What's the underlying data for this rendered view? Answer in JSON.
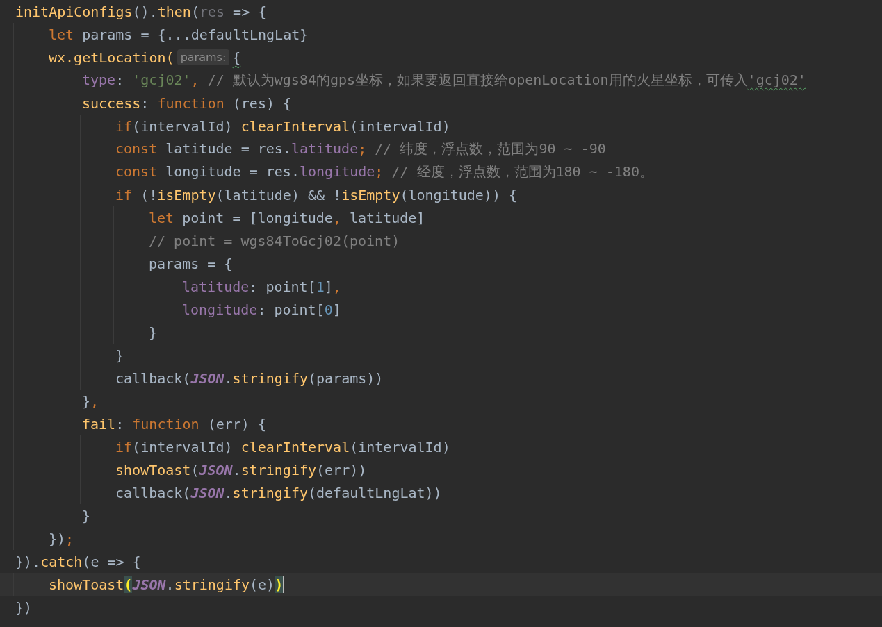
{
  "lines": [
    {
      "current": false,
      "tokens": [
        {
          "kind": "function",
          "text": "initApiConfigs"
        },
        {
          "kind": "plain",
          "text": "()."
        },
        {
          "kind": "function",
          "text": "then"
        },
        {
          "kind": "plain",
          "text": "("
        },
        {
          "kind": "unused",
          "text": "res"
        },
        {
          "kind": "plain",
          "text": " => {"
        }
      ],
      "children": [
        {
          "current": false,
          "tokens": [
            {
              "kind": "keyword",
              "text": "let"
            },
            {
              "kind": "plain",
              "text": " params = {...defaultLngLat}"
            }
          ]
        },
        {
          "current": false,
          "tokens": [
            {
              "kind": "function",
              "text": "wx.getLocation("
            },
            {
              "kind": "hint",
              "text": "params:"
            },
            {
              "kind": "flagged",
              "text": "{"
            }
          ],
          "children": [
            {
              "current": false,
              "tokens": [
                {
                  "kind": "property",
                  "text": "type"
                },
                {
                  "kind": "plain",
                  "text": ": "
                },
                {
                  "kind": "string",
                  "text": "'gcj02'"
                },
                {
                  "kind": "punct",
                  "text": ","
                },
                {
                  "kind": "comment",
                  "text": " // 默认为wgs84的gps坐标，如果要返回直接给openLocation用的火星坐标，可传入"
                },
                {
                  "kind": "flagcomment",
                  "text": "'gcj02'"
                }
              ]
            },
            {
              "current": false,
              "tokens": [
                {
                  "kind": "function",
                  "text": "success"
                },
                {
                  "kind": "plain",
                  "text": ": "
                },
                {
                  "kind": "keyword",
                  "text": "function"
                },
                {
                  "kind": "plain",
                  "text": " (res) {"
                }
              ],
              "children": [
                {
                  "current": false,
                  "tokens": [
                    {
                      "kind": "keyword",
                      "text": "if"
                    },
                    {
                      "kind": "plain",
                      "text": "(intervalId) "
                    },
                    {
                      "kind": "function",
                      "text": "clearInterval"
                    },
                    {
                      "kind": "plain",
                      "text": "(intervalId)"
                    }
                  ]
                },
                {
                  "current": false,
                  "tokens": [
                    {
                      "kind": "keyword",
                      "text": "const"
                    },
                    {
                      "kind": "plain",
                      "text": " latitude = res."
                    },
                    {
                      "kind": "property",
                      "text": "latitude"
                    },
                    {
                      "kind": "punct",
                      "text": ";"
                    },
                    {
                      "kind": "comment",
                      "text": " // 纬度，浮点数，范围为90 ~ -90"
                    }
                  ]
                },
                {
                  "current": false,
                  "tokens": [
                    {
                      "kind": "keyword",
                      "text": "const"
                    },
                    {
                      "kind": "plain",
                      "text": " longitude = res."
                    },
                    {
                      "kind": "property",
                      "text": "longitude"
                    },
                    {
                      "kind": "punct",
                      "text": ";"
                    },
                    {
                      "kind": "comment",
                      "text": " // 经度，浮点数，范围为180 ~ -180。"
                    }
                  ]
                },
                {
                  "current": false,
                  "tokens": [
                    {
                      "kind": "keyword",
                      "text": "if"
                    },
                    {
                      "kind": "plain",
                      "text": " (!"
                    },
                    {
                      "kind": "function",
                      "text": "isEmpty"
                    },
                    {
                      "kind": "plain",
                      "text": "(latitude) && !"
                    },
                    {
                      "kind": "function",
                      "text": "isEmpty"
                    },
                    {
                      "kind": "plain",
                      "text": "(longitude)) {"
                    }
                  ],
                  "children": [
                    {
                      "current": false,
                      "tokens": [
                        {
                          "kind": "keyword",
                          "text": "let"
                        },
                        {
                          "kind": "plain",
                          "text": " point = [longitude"
                        },
                        {
                          "kind": "punct",
                          "text": ","
                        },
                        {
                          "kind": "plain",
                          "text": " latitude]"
                        }
                      ]
                    },
                    {
                      "current": false,
                      "tokens": [
                        {
                          "kind": "comment",
                          "text": "// point = wgs84ToGcj02(point)"
                        }
                      ]
                    },
                    {
                      "current": false,
                      "tokens": [
                        {
                          "kind": "plain",
                          "text": "params = {"
                        }
                      ],
                      "children": [
                        {
                          "current": false,
                          "tokens": [
                            {
                              "kind": "property",
                              "text": "latitude"
                            },
                            {
                              "kind": "plain",
                              "text": ": point["
                            },
                            {
                              "kind": "number",
                              "text": "1"
                            },
                            {
                              "kind": "plain",
                              "text": "]"
                            },
                            {
                              "kind": "punct",
                              "text": ","
                            }
                          ]
                        },
                        {
                          "current": false,
                          "tokens": [
                            {
                              "kind": "property",
                              "text": "longitude"
                            },
                            {
                              "kind": "plain",
                              "text": ": point["
                            },
                            {
                              "kind": "number",
                              "text": "0"
                            },
                            {
                              "kind": "plain",
                              "text": "]"
                            }
                          ]
                        }
                      ]
                    },
                    {
                      "current": false,
                      "tokens": [
                        {
                          "kind": "plain",
                          "text": "}"
                        }
                      ]
                    }
                  ]
                },
                {
                  "current": false,
                  "tokens": [
                    {
                      "kind": "plain",
                      "text": "}"
                    }
                  ]
                },
                {
                  "current": false,
                  "tokens": [
                    {
                      "kind": "plain",
                      "text": "callback("
                    },
                    {
                      "kind": "constant",
                      "text": "JSON"
                    },
                    {
                      "kind": "plain",
                      "text": "."
                    },
                    {
                      "kind": "function",
                      "text": "stringify"
                    },
                    {
                      "kind": "plain",
                      "text": "(params))"
                    }
                  ]
                }
              ]
            },
            {
              "current": false,
              "tokens": [
                {
                  "kind": "plain",
                  "text": "}"
                },
                {
                  "kind": "punct",
                  "text": ","
                }
              ]
            },
            {
              "current": false,
              "tokens": [
                {
                  "kind": "function",
                  "text": "fail"
                },
                {
                  "kind": "plain",
                  "text": ": "
                },
                {
                  "kind": "keyword",
                  "text": "function"
                },
                {
                  "kind": "plain",
                  "text": " (err) {"
                }
              ],
              "children": [
                {
                  "current": false,
                  "tokens": [
                    {
                      "kind": "keyword",
                      "text": "if"
                    },
                    {
                      "kind": "plain",
                      "text": "(intervalId) "
                    },
                    {
                      "kind": "function",
                      "text": "clearInterval"
                    },
                    {
                      "kind": "plain",
                      "text": "(intervalId)"
                    }
                  ]
                },
                {
                  "current": false,
                  "tokens": [
                    {
                      "kind": "function",
                      "text": "showToast"
                    },
                    {
                      "kind": "plain",
                      "text": "("
                    },
                    {
                      "kind": "constant",
                      "text": "JSON"
                    },
                    {
                      "kind": "plain",
                      "text": "."
                    },
                    {
                      "kind": "function",
                      "text": "stringify"
                    },
                    {
                      "kind": "plain",
                      "text": "(err))"
                    }
                  ]
                },
                {
                  "current": false,
                  "tokens": [
                    {
                      "kind": "plain",
                      "text": "callback("
                    },
                    {
                      "kind": "constant",
                      "text": "JSON"
                    },
                    {
                      "kind": "plain",
                      "text": "."
                    },
                    {
                      "kind": "function",
                      "text": "stringify"
                    },
                    {
                      "kind": "plain",
                      "text": "(defaultLngLat))"
                    }
                  ]
                }
              ]
            },
            {
              "current": false,
              "tokens": [
                {
                  "kind": "plain",
                  "text": "}"
                }
              ]
            }
          ]
        },
        {
          "current": false,
          "tokens": [
            {
              "kind": "plain",
              "text": "})"
            },
            {
              "kind": "punct",
              "text": ";"
            }
          ]
        }
      ]
    },
    {
      "current": false,
      "tokens": [
        {
          "kind": "plain",
          "text": "})."
        },
        {
          "kind": "function",
          "text": "catch"
        },
        {
          "kind": "plain",
          "text": "(e => {"
        }
      ],
      "children": [
        {
          "current": true,
          "tokens": [
            {
              "kind": "function",
              "text": "showToast"
            },
            {
              "kind": "matched",
              "text": "("
            },
            {
              "kind": "constant",
              "text": "JSON"
            },
            {
              "kind": "plain",
              "text": "."
            },
            {
              "kind": "function",
              "text": "stringify"
            },
            {
              "kind": "plain",
              "text": "(e)"
            },
            {
              "kind": "matched",
              "text": ")"
            }
          ]
        }
      ]
    },
    {
      "current": false,
      "tokens": [
        {
          "kind": "plain",
          "text": "})"
        }
      ]
    }
  ]
}
